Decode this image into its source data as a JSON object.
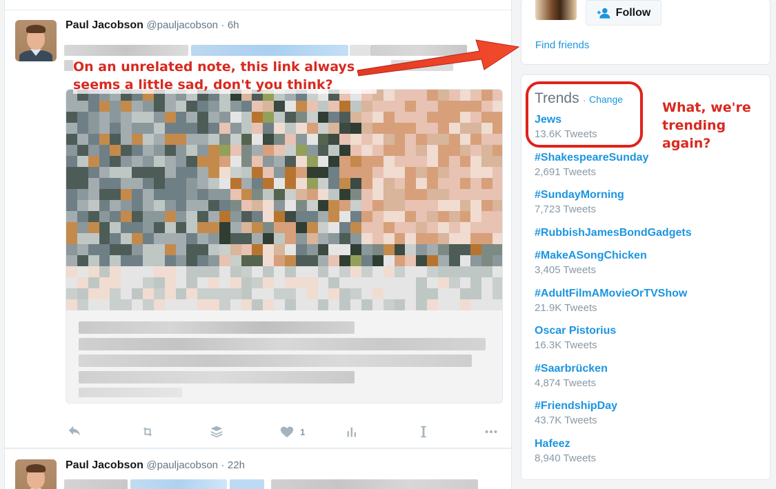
{
  "colors": {
    "link_blue": "#1b95e0",
    "annotation_red": "#d8291f",
    "muted_gray": "#8899a6"
  },
  "timeline": {
    "tweets": [
      {
        "name": "Paul Jacobson",
        "handle": "@pauljacobson",
        "time": "6h",
        "dot": "·"
      },
      {
        "name": "Paul Jacobson",
        "handle": "@pauljacobson",
        "time": "22h",
        "dot": "·"
      }
    ],
    "actions": {
      "like_count": "1",
      "icons": [
        "reply-icon",
        "retweet-icon",
        "buffer-icon",
        "like-icon",
        "analytics-icon",
        "instapaper-icon",
        "more-icon"
      ]
    }
  },
  "sidebar": {
    "who_to_follow": {
      "follow_label": "Follow",
      "find_friends": "Find friends"
    },
    "trends": {
      "title": "Trends",
      "separator": "·",
      "change": "Change",
      "items": [
        {
          "name": "Jews",
          "count": "13.6K Tweets"
        },
        {
          "name": "#ShakespeareSunday",
          "count": "2,691 Tweets"
        },
        {
          "name": "#SundayMorning",
          "count": "7,723 Tweets"
        },
        {
          "name": "#RubbishJamesBondGadgets",
          "count": ""
        },
        {
          "name": "#MakeASongChicken",
          "count": "3,405 Tweets"
        },
        {
          "name": "#AdultFilmAMovieOrTVShow",
          "count": "21.9K Tweets"
        },
        {
          "name": "Oscar Pistorius",
          "count": "16.3K Tweets"
        },
        {
          "name": "#Saarbrücken",
          "count": "4,874 Tweets"
        },
        {
          "name": "#FriendshipDay",
          "count": "43.7K Tweets"
        },
        {
          "name": "Hafeez",
          "count": "8,940 Tweets"
        }
      ]
    }
  },
  "annotations": {
    "note_link_line1": "On an unrelated note, this link always",
    "note_link_line2": "seems a little sad, don't you think?",
    "note_trend_line1": "What, we're",
    "note_trend_line2": "trending",
    "note_trend_line3": "again?"
  }
}
